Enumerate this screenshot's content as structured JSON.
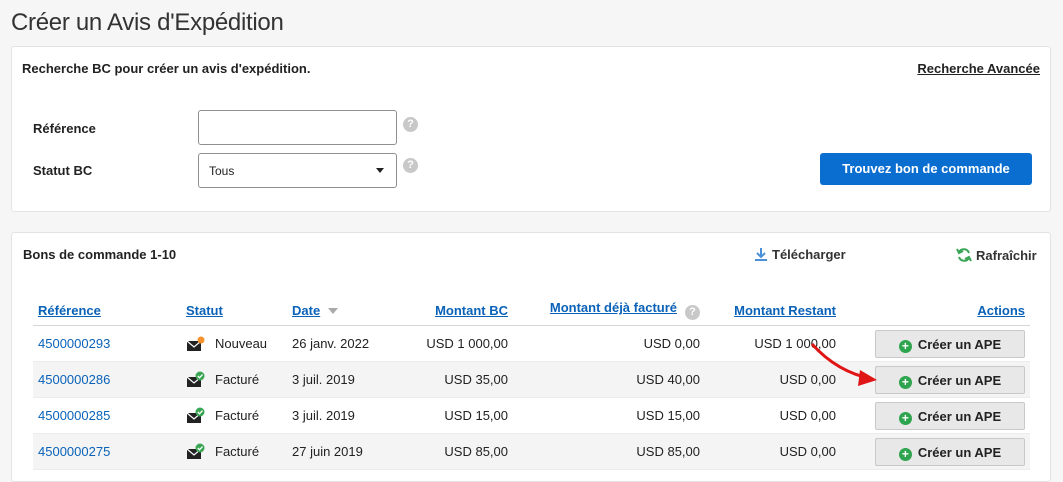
{
  "page": {
    "title": "Créer un Avis d'Expédition"
  },
  "search": {
    "header": "Recherche BC pour créer un avis d'expédition.",
    "advanced_link": "Recherche Avancée",
    "reference_label": "Référence",
    "reference_value": "",
    "status_label": "Statut BC",
    "status_value": "Tous",
    "help_glyph": "?",
    "submit_label": "Trouvez bon de commande"
  },
  "results": {
    "title": "Bons de commande 1-10",
    "download_label": "Télécharger",
    "refresh_label": "Rafraîchir",
    "columns": {
      "reference": "Référence",
      "status": "Statut",
      "date": "Date",
      "amount": "Montant BC",
      "invoiced": "Montant déjà facturé",
      "remaining": "Montant Restant",
      "actions": "Actions"
    },
    "rows": [
      {
        "reference": "4500000293",
        "status": "Nouveau",
        "status_icon": "new-order-icon",
        "date": "26 janv. 2022",
        "amount": "USD 1 000,00",
        "invoiced": "USD 0,00",
        "remaining": "USD 1 000,00",
        "action": "Créer un APE"
      },
      {
        "reference": "4500000286",
        "status": "Facturé",
        "status_icon": "invoiced-icon",
        "date": "3 juil. 2019",
        "amount": "USD 35,00",
        "invoiced": "USD 40,00",
        "remaining": "USD 0,00",
        "action": "Créer un APE"
      },
      {
        "reference": "4500000285",
        "status": "Facturé",
        "status_icon": "invoiced-icon",
        "date": "3 juil. 2019",
        "amount": "USD 15,00",
        "invoiced": "USD 15,00",
        "remaining": "USD 0,00",
        "action": "Créer un APE"
      },
      {
        "reference": "4500000275",
        "status": "Facturé",
        "status_icon": "invoiced-icon",
        "date": "27 juin 2019",
        "amount": "USD 85,00",
        "invoiced": "USD 85,00",
        "remaining": "USD 0,00",
        "action": "Créer un APE"
      }
    ]
  },
  "colors": {
    "primary": "#0a6ed1",
    "link": "#0a62b8",
    "annotation_arrow": "#e01515",
    "success": "#2ea44f"
  }
}
